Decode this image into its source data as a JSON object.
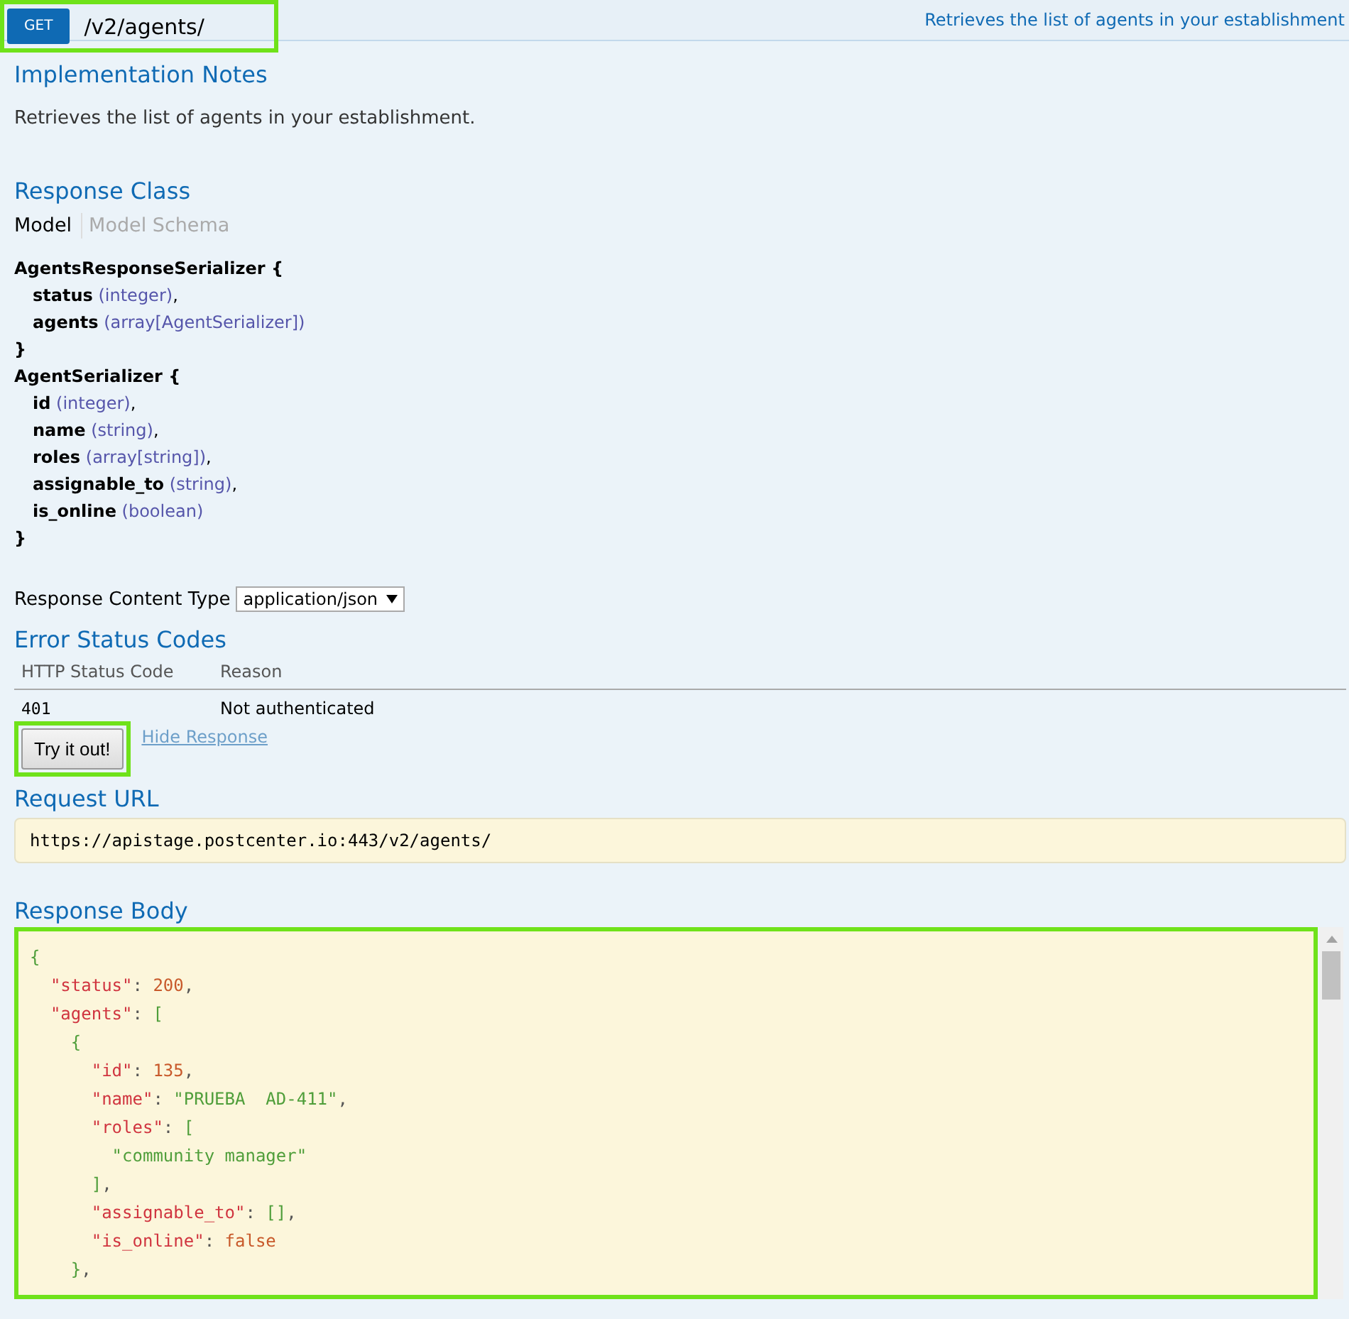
{
  "operation": {
    "method": "GET",
    "path": "/v2/agents/",
    "summary": "Retrieves the list of agents in your establishment",
    "highlighted": true
  },
  "implementation_notes": {
    "title": "Implementation Notes",
    "text": "Retrieves the list of agents in your establishment."
  },
  "response_class": {
    "title": "Response Class",
    "tabs": [
      {
        "label": "Model",
        "selected": true
      },
      {
        "label": "Model Schema",
        "selected": false
      }
    ],
    "models": [
      {
        "name": "AgentsResponseSerializer {",
        "fields": [
          {
            "name": "status",
            "type": "(integer)",
            "sep": ","
          },
          {
            "name": "agents",
            "type": "(array[AgentSerializer])"
          }
        ],
        "close": "}"
      },
      {
        "name": "AgentSerializer {",
        "fields": [
          {
            "name": "id",
            "type": "(integer)",
            "sep": ","
          },
          {
            "name": "name",
            "type": "(string)",
            "sep": ","
          },
          {
            "name": "roles",
            "type": "(array[string])",
            "sep": ","
          },
          {
            "name": "assignable_to",
            "type": "(string)",
            "sep": ","
          },
          {
            "name": "is_online",
            "type": "(boolean)"
          }
        ],
        "close": "}"
      }
    ]
  },
  "content_type": {
    "label": "Response Content Type",
    "value": "application/json"
  },
  "error_codes": {
    "title": "Error Status Codes",
    "columns": [
      "HTTP Status Code",
      "Reason"
    ],
    "rows": [
      [
        "401",
        "Not authenticated"
      ]
    ]
  },
  "try_button": {
    "label": "Try it out!",
    "highlighted": true
  },
  "hide_link": "Hide Response",
  "request_url": {
    "title": "Request URL",
    "value": "https://apistage.postcenter.io:443/v2/agents/"
  },
  "response_body": {
    "title": "Response Body",
    "highlighted": true,
    "lines": [
      [
        {
          "kind": "bracket",
          "text": "{"
        }
      ],
      [
        {
          "kind": "key",
          "text": "  \"status\""
        },
        {
          "kind": "plain",
          "text": ": "
        },
        {
          "kind": "number",
          "text": "200"
        },
        {
          "kind": "plain",
          "text": ","
        }
      ],
      [
        {
          "kind": "key",
          "text": "  \"agents\""
        },
        {
          "kind": "plain",
          "text": ": "
        },
        {
          "kind": "bracket",
          "text": "["
        }
      ],
      [
        {
          "kind": "bracket",
          "text": "    {"
        }
      ],
      [
        {
          "kind": "key",
          "text": "      \"id\""
        },
        {
          "kind": "plain",
          "text": ": "
        },
        {
          "kind": "number",
          "text": "135"
        },
        {
          "kind": "plain",
          "text": ","
        }
      ],
      [
        {
          "kind": "key",
          "text": "      \"name\""
        },
        {
          "kind": "plain",
          "text": ": "
        },
        {
          "kind": "string",
          "text": "\"PRUEBA  AD-411\""
        },
        {
          "kind": "plain",
          "text": ","
        }
      ],
      [
        {
          "kind": "key",
          "text": "      \"roles\""
        },
        {
          "kind": "plain",
          "text": ": "
        },
        {
          "kind": "bracket",
          "text": "["
        }
      ],
      [
        {
          "kind": "string",
          "text": "        \"community manager\""
        }
      ],
      [
        {
          "kind": "bracket",
          "text": "      ]"
        },
        {
          "kind": "plain",
          "text": ","
        }
      ],
      [
        {
          "kind": "key",
          "text": "      \"assignable_to\""
        },
        {
          "kind": "plain",
          "text": ": "
        },
        {
          "kind": "bracket",
          "text": "[]"
        },
        {
          "kind": "plain",
          "text": ","
        }
      ],
      [
        {
          "kind": "key",
          "text": "      \"is_online\""
        },
        {
          "kind": "plain",
          "text": ": "
        },
        {
          "kind": "number",
          "text": "false"
        }
      ],
      [
        {
          "kind": "bracket",
          "text": "    }"
        },
        {
          "kind": "plain",
          "text": ","
        }
      ]
    ]
  }
}
